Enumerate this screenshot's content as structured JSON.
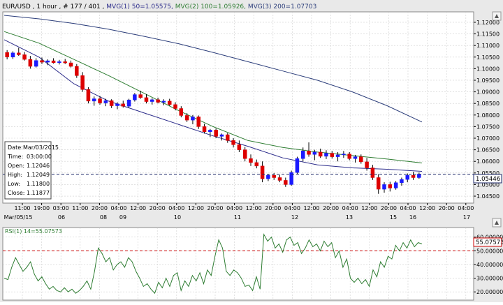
{
  "header": {
    "symbol": "EUR/USD",
    "timeframe": " , 1 hour , # 177 / 401 ,",
    "ma1": " MVG(1) 50=1.05575,",
    "ma2": " MVG(2) 100=1.05926,",
    "ma3": " MVG(3) 200=1.07703"
  },
  "colors": {
    "bull": "#1a1aff",
    "bear": "#dd0000",
    "ma50": "#2b2b8a",
    "ma100": "#2e7d32",
    "ma200": "#2b3d7a",
    "rsi": "#2e7d32",
    "current_line": "#1f2a6b",
    "rsi_level": "#cc0000",
    "grid": "#d0d0d0",
    "panel_bg": "#ffffff",
    "window_bg": "#e9e9e9"
  },
  "info_box": {
    "date_label": "Date:",
    "date": "Mar/03/2015",
    "time_label": "Time:",
    "time": "03:00:00",
    "open_label": "Open:",
    "open": "1.12046",
    "high_label": "High:",
    "high": "1.12049",
    "low_label": "Low:",
    "low": "1.11800",
    "close_label": "Close:",
    "close": "1.11877"
  },
  "chart_data": [
    {
      "type": "candlestick",
      "title": "",
      "y_ticks": [
        "1.12000",
        "1.11500",
        "1.11000",
        "1.10500",
        "1.10000",
        "1.09500",
        "1.09000",
        "1.08500",
        "1.08000",
        "1.07500",
        "1.07000",
        "1.06500",
        "1.06000",
        "1.05500",
        "1.05000",
        "1.04500"
      ],
      "ylim": [
        1.042,
        1.1245
      ],
      "current_price": 1.05446,
      "current_price_label": "1.05446",
      "x_time_labels": [
        "11:00",
        "19:00",
        "03:00",
        "11:00",
        "20:00",
        "04:00",
        "12:00",
        "20:00",
        "04:00",
        "12:00",
        "20:00",
        "04:00",
        "12:00",
        "20:00",
        "04:00",
        "12:00",
        "20:00",
        "04:00",
        "12:00",
        "20:00",
        "04:00",
        "12:00",
        "20:00",
        "04:00"
      ],
      "x_date_labels": [
        "Mar/05/15",
        "06",
        "08",
        "09",
        "10",
        "11",
        "12",
        "13",
        "15",
        "16",
        "17"
      ],
      "ohlc": [
        [
          1.107,
          1.108,
          1.104,
          1.105
        ],
        [
          1.105,
          1.1075,
          1.1042,
          1.1068
        ],
        [
          1.1068,
          1.109,
          1.1055,
          1.106
        ],
        [
          1.106,
          1.1072,
          1.1035,
          1.104
        ],
        [
          1.104,
          1.1055,
          1.1,
          1.101
        ],
        [
          1.101,
          1.1045,
          1.1005,
          1.1035
        ],
        [
          1.1035,
          1.1048,
          1.102,
          1.1028
        ],
        [
          1.1028,
          1.104,
          1.1015,
          1.1034
        ],
        [
          1.1034,
          1.1045,
          1.1022,
          1.1026
        ],
        [
          1.1026,
          1.1038,
          1.1018,
          1.103
        ],
        [
          1.103,
          1.1042,
          1.102,
          1.1025
        ],
        [
          1.1025,
          1.1035,
          1.1005,
          1.101
        ],
        [
          1.101,
          1.102,
          1.096,
          1.097
        ],
        [
          1.097,
          1.0985,
          1.09,
          1.091
        ],
        [
          1.091,
          1.092,
          1.085,
          1.086
        ],
        [
          1.086,
          1.088,
          1.084,
          1.087
        ],
        [
          1.087,
          1.0882,
          1.0845,
          1.0852
        ],
        [
          1.0852,
          1.087,
          1.0838,
          1.0862
        ],
        [
          1.0862,
          1.0868,
          1.083,
          1.084
        ],
        [
          1.084,
          1.0855,
          1.0825,
          1.0848
        ],
        [
          1.0848,
          1.0862,
          1.0832,
          1.0838
        ],
        [
          1.0838,
          1.087,
          1.083,
          1.0865
        ],
        [
          1.0865,
          1.0895,
          1.0858,
          1.0888
        ],
        [
          1.0888,
          1.0905,
          1.087,
          1.0875
        ],
        [
          1.0875,
          1.089,
          1.085,
          1.0858
        ],
        [
          1.0858,
          1.0872,
          1.0845,
          1.0866
        ],
        [
          1.0866,
          1.0875,
          1.085,
          1.0855
        ],
        [
          1.0855,
          1.0868,
          1.0842,
          1.086
        ],
        [
          1.086,
          1.087,
          1.084,
          1.0845
        ],
        [
          1.0845,
          1.0855,
          1.082,
          1.0828
        ],
        [
          1.0828,
          1.0838,
          1.079,
          1.0798
        ],
        [
          1.0798,
          1.0808,
          1.077,
          1.0778
        ],
        [
          1.0778,
          1.08,
          1.076,
          1.0792
        ],
        [
          1.0792,
          1.0798,
          1.074,
          1.075
        ],
        [
          1.075,
          1.0762,
          1.072,
          1.0728
        ],
        [
          1.0728,
          1.074,
          1.0705,
          1.0735
        ],
        [
          1.0735,
          1.0742,
          1.07,
          1.0708
        ],
        [
          1.0708,
          1.072,
          1.069,
          1.0715
        ],
        [
          1.0715,
          1.0722,
          1.068,
          1.069
        ],
        [
          1.069,
          1.07,
          1.066,
          1.0672
        ],
        [
          1.0672,
          1.069,
          1.064,
          1.065
        ],
        [
          1.065,
          1.0662,
          1.06,
          1.0612
        ],
        [
          1.0612,
          1.063,
          1.058,
          1.0595
        ],
        [
          1.0595,
          1.0608,
          1.057,
          1.058
        ],
        [
          1.058,
          1.06,
          1.051,
          1.0525
        ],
        [
          1.0525,
          1.0545,
          1.0515,
          1.054
        ],
        [
          1.054,
          1.055,
          1.052,
          1.053
        ],
        [
          1.053,
          1.0542,
          1.051,
          1.0518
        ],
        [
          1.0518,
          1.053,
          1.049,
          1.05
        ],
        [
          1.05,
          1.056,
          1.0495,
          1.0552
        ],
        [
          1.0552,
          1.062,
          1.0545,
          1.0612
        ],
        [
          1.0612,
          1.066,
          1.06,
          1.0645
        ],
        [
          1.0645,
          1.0682,
          1.062,
          1.063
        ],
        [
          1.063,
          1.065,
          1.0605,
          1.064
        ],
        [
          1.064,
          1.0655,
          1.0615,
          1.0622
        ],
        [
          1.0622,
          1.0648,
          1.061,
          1.0635
        ],
        [
          1.0635,
          1.0645,
          1.0612,
          1.062
        ],
        [
          1.062,
          1.064,
          1.06,
          1.0628
        ],
        [
          1.0628,
          1.0645,
          1.0615,
          1.0632
        ],
        [
          1.0632,
          1.064,
          1.0605,
          1.0612
        ],
        [
          1.0612,
          1.0628,
          1.0595,
          1.062
        ],
        [
          1.062,
          1.063,
          1.059,
          1.0598
        ],
        [
          1.0598,
          1.0615,
          1.056,
          1.0572
        ],
        [
          1.0572,
          1.0585,
          1.052,
          1.053
        ],
        [
          1.053,
          1.0545,
          1.046,
          1.048
        ],
        [
          1.048,
          1.051,
          1.0465,
          1.05
        ],
        [
          1.05,
          1.0512,
          1.047,
          1.0485
        ],
        [
          1.0485,
          1.0515,
          1.0478,
          1.0508
        ],
        [
          1.0508,
          1.053,
          1.0495,
          1.0522
        ],
        [
          1.0522,
          1.0548,
          1.051,
          1.054
        ],
        [
          1.054,
          1.0555,
          1.052,
          1.053
        ],
        [
          1.053,
          1.0552,
          1.0525,
          1.0545
        ]
      ],
      "series": [
        {
          "name": "MVG(1) 50",
          "values": [
            1.1125,
            1.105,
            1.0935,
            1.086,
            1.081,
            1.076,
            1.071,
            1.0665,
            1.0615,
            1.0585,
            1.0572,
            1.0566,
            1.0557
          ]
        },
        {
          "name": "MVG(2) 100",
          "values": [
            1.116,
            1.111,
            1.104,
            1.097,
            1.0895,
            1.082,
            1.075,
            1.069,
            1.066,
            1.064,
            1.0625,
            1.061,
            1.0593
          ]
        },
        {
          "name": "MVG(3) 200",
          "values": [
            1.123,
            1.1215,
            1.1195,
            1.117,
            1.114,
            1.1108,
            1.107,
            1.103,
            1.099,
            1.095,
            1.09,
            1.084,
            1.077
          ]
        }
      ]
    },
    {
      "type": "line",
      "title": "RSI(1) 14=55.07573",
      "y_ticks": [
        "60.00000",
        "50.00000",
        "40.00000",
        "30.00000",
        "20.00000"
      ],
      "ylim": [
        14,
        67
      ],
      "level": 50,
      "current_value_label": "55.07573",
      "series": [
        {
          "name": "RSI(1) 14",
          "values": [
            30,
            29,
            38,
            45,
            40,
            35,
            38,
            42,
            33,
            28,
            31,
            26,
            22,
            24,
            21,
            20,
            23,
            20,
            22,
            19,
            21,
            24,
            28,
            22,
            35,
            52,
            48,
            42,
            45,
            36,
            40,
            42,
            38,
            45,
            42,
            35,
            30,
            24,
            26,
            22,
            19,
            27,
            23,
            30,
            24,
            32,
            34,
            21,
            28,
            24,
            32,
            28,
            34,
            26,
            36,
            32,
            46,
            58,
            52,
            35,
            32,
            36,
            34,
            30,
            24,
            25,
            21,
            31,
            22,
            62,
            57,
            60,
            52,
            55,
            49,
            58,
            60,
            54,
            56,
            48,
            52,
            58,
            53,
            55,
            50,
            57,
            53,
            56,
            45,
            50,
            38,
            44,
            30,
            27,
            30,
            26,
            29,
            24,
            36,
            31,
            42,
            38,
            46,
            44,
            54,
            50,
            56,
            52,
            58,
            53,
            56,
            55
          ]
        }
      ]
    }
  ]
}
